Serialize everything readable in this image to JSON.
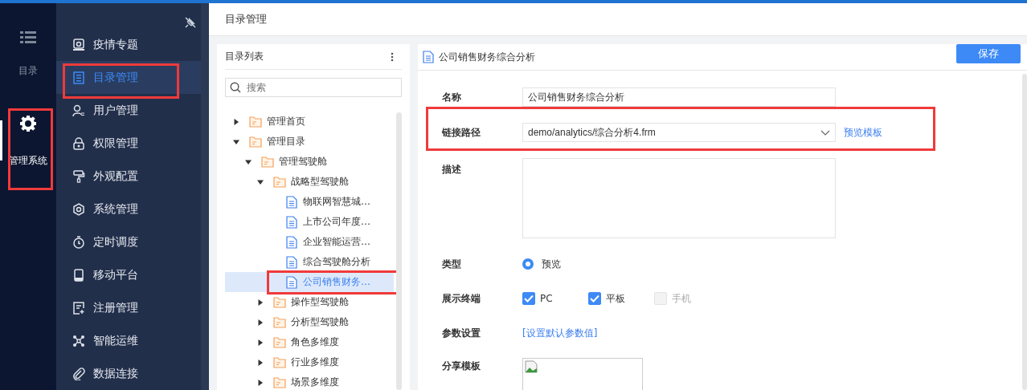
{
  "rail": [
    {
      "label": "目录",
      "selected": false,
      "highlighted": false
    },
    {
      "label": "管理系统",
      "selected": true,
      "highlighted": true
    }
  ],
  "nav": {
    "items": [
      {
        "label": "疫情专题",
        "selected": false,
        "highlighted": false
      },
      {
        "label": "目录管理",
        "selected": true,
        "highlighted": true
      },
      {
        "label": "用户管理",
        "selected": false,
        "highlighted": false
      },
      {
        "label": "权限管理",
        "selected": false,
        "highlighted": false
      },
      {
        "label": "外观配置",
        "selected": false,
        "highlighted": false
      },
      {
        "label": "系统管理",
        "selected": false,
        "highlighted": false
      },
      {
        "label": "定时调度",
        "selected": false,
        "highlighted": false
      },
      {
        "label": "移动平台",
        "selected": false,
        "highlighted": false
      },
      {
        "label": "注册管理",
        "selected": false,
        "highlighted": false
      },
      {
        "label": "智能运维",
        "selected": false,
        "highlighted": false
      },
      {
        "label": "数据连接",
        "selected": false,
        "highlighted": false
      }
    ]
  },
  "page": {
    "title": "目录管理"
  },
  "tree_panel": {
    "title": "目录列表",
    "search": {
      "placeholder": "搜索"
    },
    "items": [
      {
        "label": "管理首页",
        "kind": "folder",
        "expanded": false,
        "selected": false,
        "highlighted": false
      },
      {
        "label": "管理目录",
        "kind": "folder",
        "expanded": true,
        "selected": false,
        "highlighted": false,
        "children": [
          {
            "label": "管理驾驶舱",
            "kind": "folder",
            "expanded": true,
            "selected": false,
            "highlighted": false,
            "children": [
              {
                "label": "战略型驾驶舱",
                "kind": "folder",
                "expanded": true,
                "selected": false,
                "highlighted": false,
                "children": [
                  {
                    "label": "物联网智慧城…",
                    "kind": "file",
                    "selected": false,
                    "highlighted": false
                  },
                  {
                    "label": "上市公司年度…",
                    "kind": "file",
                    "selected": false,
                    "highlighted": false
                  },
                  {
                    "label": "企业智能运营…",
                    "kind": "file",
                    "selected": false,
                    "highlighted": false
                  },
                  {
                    "label": "综合驾驶舱分析",
                    "kind": "file",
                    "selected": false,
                    "highlighted": false
                  },
                  {
                    "label": "公司销售财务…",
                    "kind": "file",
                    "selected": true,
                    "highlighted": true
                  }
                ]
              },
              {
                "label": "操作型驾驶舱",
                "kind": "folder",
                "expanded": false,
                "selected": false,
                "highlighted": false
              },
              {
                "label": "分析型驾驶舱",
                "kind": "folder",
                "expanded": false,
                "selected": false,
                "highlighted": false
              },
              {
                "label": "角色多维度",
                "kind": "folder",
                "expanded": false,
                "selected": false,
                "highlighted": false
              },
              {
                "label": "行业多维度",
                "kind": "folder",
                "expanded": false,
                "selected": false,
                "highlighted": false
              },
              {
                "label": "场景多维度",
                "kind": "folder",
                "expanded": false,
                "selected": false,
                "highlighted": false
              }
            ]
          }
        ]
      }
    ]
  },
  "detail": {
    "title": "公司销售财务综合分析",
    "save_button": "保存",
    "fields": [
      {
        "kind": "text",
        "label": "名称",
        "value": "公司销售财务综合分析",
        "highlighted": false
      },
      {
        "kind": "select",
        "label": "链接路径",
        "value": "demo/analytics/综合分析4.frm",
        "link": "预览模板",
        "highlighted": true
      },
      {
        "kind": "textarea",
        "label": "描述",
        "highlighted": false
      },
      {
        "kind": "radio",
        "label": "类型",
        "options": [
          {
            "label": "预览",
            "selected": true
          }
        ],
        "highlighted": false
      },
      {
        "kind": "checkbox",
        "label": "展示终端",
        "options": [
          {
            "label": "PC",
            "checked": true,
            "disabled": false
          },
          {
            "label": "平板",
            "checked": true,
            "disabled": false
          },
          {
            "label": "手机",
            "checked": false,
            "disabled": true
          }
        ],
        "highlighted": false
      },
      {
        "kind": "link",
        "label": "参数设置",
        "link": "[设置默认参数值]",
        "highlighted": false
      },
      {
        "kind": "image",
        "label": "分享模板",
        "highlighted": false
      }
    ]
  }
}
